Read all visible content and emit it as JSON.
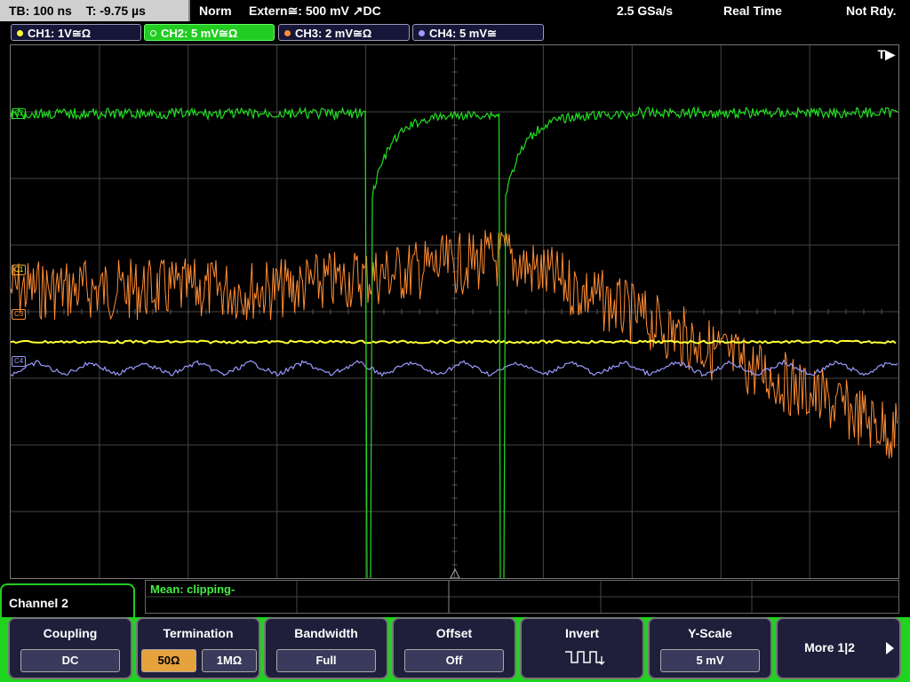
{
  "topbar": {
    "timebase": "TB: 100 ns",
    "trigger_time": "T: -9.75 µs",
    "mode": "Norm",
    "trigger_source": "Extern≅: 500 mV ↗DC",
    "sample_rate": "2.5 GSa/s",
    "acq_mode": "Real Time",
    "status": "Not Rdy."
  },
  "channels": [
    {
      "label": "CH1: 1V≅Ω",
      "color": "#ffff33"
    },
    {
      "label": "CH2: 5 mV≅Ω",
      "color": "#22dd22"
    },
    {
      "label": "CH3: 2 mV≅Ω",
      "color": "#ff8c33"
    },
    {
      "label": "CH4: 5 mV≅",
      "color": "#9a9aff"
    }
  ],
  "screen": {
    "trigger_marker": "T▶",
    "offset_labels": {
      "c2": "C2",
      "c1": "C1",
      "c3": "C3",
      "c4": "C4"
    }
  },
  "measurement": {
    "text": "Mean: clipping-"
  },
  "menu": {
    "title": "Channel 2",
    "coupling": {
      "title": "Coupling",
      "value": "DC"
    },
    "termination": {
      "title": "Termination",
      "opt1": "50Ω",
      "opt2": "1MΩ"
    },
    "bandwidth": {
      "title": "Bandwidth",
      "value": "Full"
    },
    "offset": {
      "title": "Offset",
      "value": "Off"
    },
    "invert": {
      "title": "Invert",
      "icon": "inverted-square-wave-icon"
    },
    "yscale": {
      "title": "Y-Scale",
      "value": "5 mV"
    },
    "more": {
      "label": "More 1|2"
    }
  },
  "colors": {
    "grid": "#444444",
    "ch1": "#ffff33",
    "ch2": "#22dd22",
    "ch3": "#ff8c33",
    "ch4": "#9a9aff",
    "softbar_bg": "#1fd41f"
  }
}
